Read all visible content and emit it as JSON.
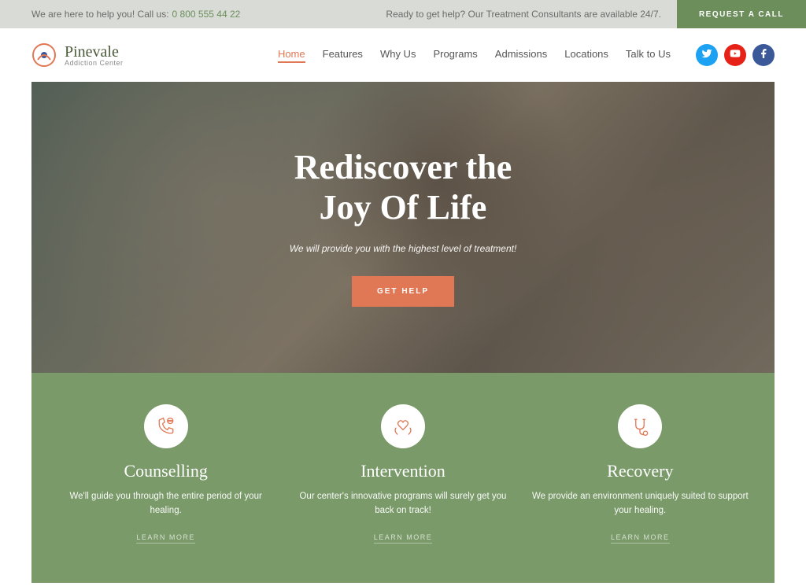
{
  "topbar": {
    "help_text": "We are here to help you! Call us:",
    "phone": "0 800 555 44 22",
    "ready_text": "Ready to get help? Our Treatment Consultants are available 24/7.",
    "request_label": "REQUEST A CALL"
  },
  "logo": {
    "name": "Pinevale",
    "sub": "Addiction Center"
  },
  "nav": {
    "items": [
      {
        "label": "Home",
        "active": true
      },
      {
        "label": "Features",
        "active": false
      },
      {
        "label": "Why Us",
        "active": false
      },
      {
        "label": "Programs",
        "active": false
      },
      {
        "label": "Admissions",
        "active": false
      },
      {
        "label": "Locations",
        "active": false
      },
      {
        "label": "Talk to Us",
        "active": false
      }
    ]
  },
  "hero": {
    "title_line1": "Rediscover the",
    "title_line2": "Joy Of Life",
    "subtitle": "We will provide you with the highest level of treatment!",
    "cta": "GET HELP"
  },
  "services": [
    {
      "icon": "phone-chat-icon",
      "title": "Counselling",
      "desc": "We'll guide you through the entire period of your healing.",
      "link": "LEARN MORE"
    },
    {
      "icon": "hands-heart-icon",
      "title": "Intervention",
      "desc": "Our center's innovative programs will surely get you back on track!",
      "link": "LEARN MORE"
    },
    {
      "icon": "stethoscope-icon",
      "title": "Recovery",
      "desc": "We provide an environment uniquely suited to support your healing.",
      "link": "LEARN MORE"
    }
  ],
  "colors": {
    "accent": "#e07856",
    "green": "#6b8e5a",
    "services_bg": "#7a9a6a"
  }
}
